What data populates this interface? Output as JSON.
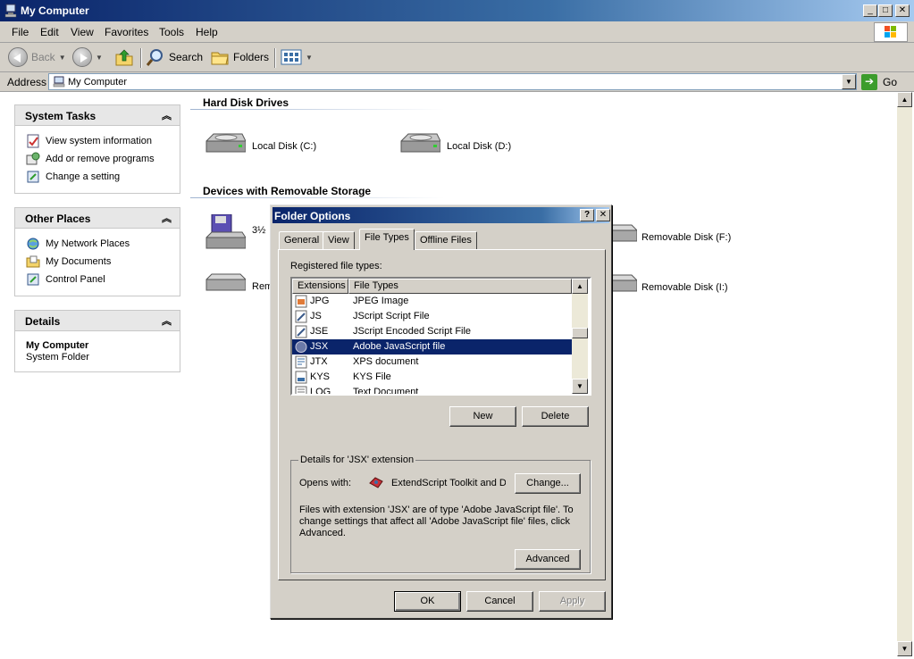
{
  "window": {
    "title": "My Computer"
  },
  "menu": [
    "File",
    "Edit",
    "View",
    "Favorites",
    "Tools",
    "Help"
  ],
  "toolbar": {
    "back": "Back",
    "search": "Search",
    "folders": "Folders"
  },
  "address": {
    "label": "Address",
    "value": "My Computer",
    "go": "Go"
  },
  "tasks": {
    "system": {
      "title": "System Tasks",
      "items": [
        "View system information",
        "Add or remove programs",
        "Change a setting"
      ]
    },
    "other": {
      "title": "Other Places",
      "items": [
        "My Network Places",
        "My Documents",
        "Control Panel"
      ]
    },
    "details": {
      "title": "Details",
      "name": "My Computer",
      "type": "System Folder"
    }
  },
  "sections": {
    "hdd": {
      "title": "Hard Disk Drives",
      "drives": [
        "Local Disk (C:)",
        "Local Disk (D:)"
      ]
    },
    "removable": {
      "title": "Devices with Removable Storage",
      "drives": [
        "3½",
        "Removable Disk (F:)",
        "Rem",
        "Removable Disk (I:)"
      ]
    }
  },
  "dialog": {
    "title": "Folder Options",
    "help_btn": "?",
    "close_btn": "✕",
    "tabs": [
      "General",
      "View",
      "File Types",
      "Offline Files"
    ],
    "active_tab": "File Types",
    "registered_label": "Registered file types:",
    "columns": [
      "Extensions",
      "File Types"
    ],
    "rows": [
      {
        "ext": "JPG",
        "type": "JPEG Image"
      },
      {
        "ext": "JS",
        "type": "JScript Script File"
      },
      {
        "ext": "JSE",
        "type": "JScript Encoded Script File"
      },
      {
        "ext": "JSX",
        "type": "Adobe JavaScript file"
      },
      {
        "ext": "JTX",
        "type": "XPS document"
      },
      {
        "ext": "KYS",
        "type": "KYS File"
      },
      {
        "ext": "LOG",
        "type": "Text Document"
      }
    ],
    "selected_row": 3,
    "new_btn": "New",
    "delete_btn": "Delete",
    "details_legend": "Details for 'JSX' extension",
    "opens_with_label": "Opens with:",
    "opens_with_app": "ExtendScript Toolkit and D",
    "change_btn": "Change...",
    "description": "Files with extension 'JSX' are of type 'Adobe JavaScript file'.  To change settings that affect all 'Adobe JavaScript file' files, click Advanced.",
    "advanced_btn": "Advanced",
    "ok_btn": "OK",
    "cancel_btn": "Cancel",
    "apply_btn": "Apply"
  },
  "colors": {
    "titlebar": "#0a246a",
    "selection": "#0a246a",
    "face": "#d4d0c8"
  }
}
